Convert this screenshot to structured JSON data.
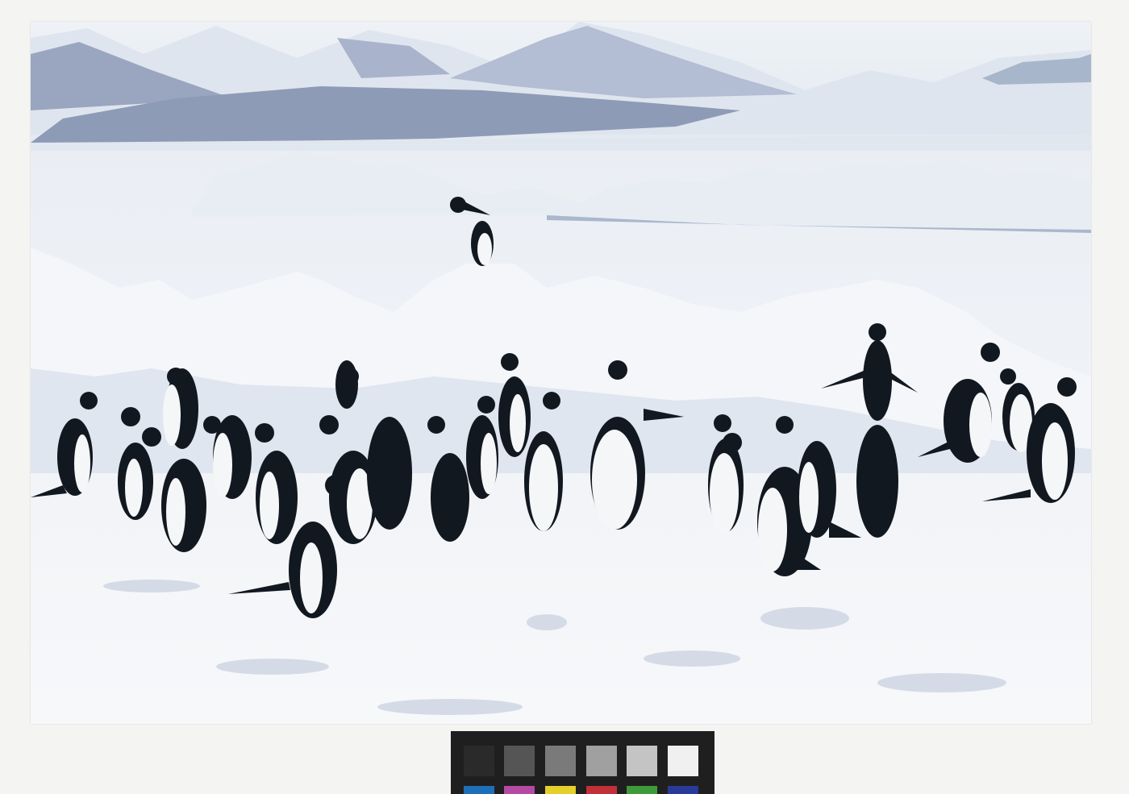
{
  "image": {
    "kind": "photograph",
    "subject": "penguins",
    "colors": {
      "sky": "#e9eef4",
      "mountain_shadow": "#8e9bb7",
      "snow": "#f3f5f8",
      "snow_shadow": "#c9d3e3",
      "penguin_black": "#121820",
      "penguin_white": "#f5f6f8",
      "mount": "#f4f4f2"
    }
  },
  "color_target": {
    "gray_patches": [
      "#2a2a2a",
      "#555555",
      "#7a7a7a",
      "#a0a0a0",
      "#c4c4c4",
      "#f0f0f0"
    ],
    "color_patches": [
      "#1f6fb8",
      "#b54aa3",
      "#e5cf2a",
      "#c2303a",
      "#3f9b3a",
      "#2a3a9a"
    ]
  }
}
